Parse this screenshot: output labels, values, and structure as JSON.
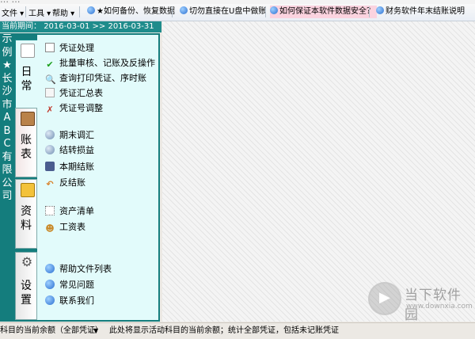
{
  "window": {
    "title": "… … ·"
  },
  "menubar": {
    "menus": [
      "文件",
      "工具",
      "帮助"
    ],
    "links": [
      {
        "label": "★如何备份、恢复数据",
        "highlight": false
      },
      {
        "label": "切勿直接在U盘中做账",
        "highlight": false
      },
      {
        "label": "如何保证本软件数据安全？",
        "highlight": true
      },
      {
        "label": "财务软件年末结账说明",
        "highlight": false
      }
    ]
  },
  "period": {
    "label": "当前期间：",
    "start": "2016-03-01",
    "sep": ">>",
    "end": "2016-03-31"
  },
  "company": {
    "chars": [
      "示",
      "例",
      "★",
      "长",
      "沙",
      "市",
      "A",
      "B",
      "C",
      "有",
      "限",
      "公",
      "司"
    ]
  },
  "tabs": [
    {
      "label_lines": [
        "日",
        "常"
      ],
      "icon": "document-icon",
      "active": true
    },
    {
      "label_lines": [
        "账",
        "表"
      ],
      "icon": "ledger-book-icon",
      "active": false
    },
    {
      "label_lines": [
        "资",
        "料"
      ],
      "icon": "archive-icon",
      "active": false
    },
    {
      "label_lines": [
        "设",
        "置"
      ],
      "icon": "gear-icon",
      "active": false
    }
  ],
  "panel": {
    "items": [
      {
        "label": "凭证处理",
        "icon": "edit-document-icon"
      },
      {
        "label": "批量审核、记账及反操作",
        "icon": "checkmark-icon"
      },
      {
        "label": "查询打印凭证、序时账",
        "icon": "search-print-icon"
      },
      {
        "label": "凭证汇总表",
        "icon": "summary-sheet-icon"
      },
      {
        "label": "凭证号调整",
        "icon": "tools-icon"
      },
      {
        "label": "期末调汇",
        "icon": "globe-gear-icon"
      },
      {
        "label": "结转损益",
        "icon": "globe-gear-icon"
      },
      {
        "label": "本期结账",
        "icon": "calculator-icon"
      },
      {
        "label": "反结账",
        "icon": "undo-arrow-icon"
      },
      {
        "label": "资产清单",
        "icon": "asset-list-icon"
      },
      {
        "label": "工资表",
        "icon": "people-icon"
      },
      {
        "label": "帮助文件列表",
        "icon": "ie-icon"
      },
      {
        "label": "常见问题",
        "icon": "ie-icon"
      },
      {
        "label": "联系我们",
        "icon": "ie-icon"
      }
    ]
  },
  "watermark": {
    "name": "当下软件园",
    "url": "www.downxia.com"
  },
  "statusbar": {
    "left": "科目的当前余额（全部凭证）",
    "right": "此处将显示活动科目的当前余额；统计全部凭证，包括未记账凭证"
  },
  "colors": {
    "teal_dark": "#147d7d",
    "teal": "#1f8c8c",
    "panel_bg": "#e2fbfb",
    "highlight_pink": "#fbd3df"
  }
}
